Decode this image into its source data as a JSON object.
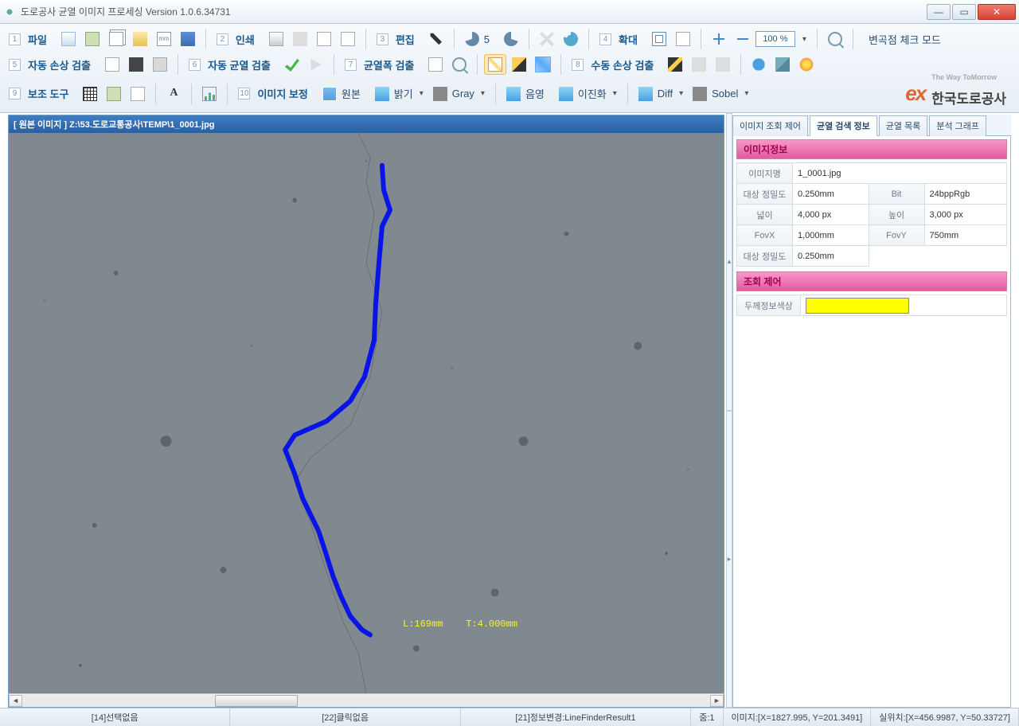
{
  "window": {
    "title": "도로공사 균열 이미지 프로세싱 Version 1.0.6.34731"
  },
  "toolbar": {
    "file": {
      "num": "1",
      "label": "파일"
    },
    "print": {
      "num": "2",
      "label": "인쇄"
    },
    "edit": {
      "num": "3",
      "label": "편집"
    },
    "zoom": {
      "num": "4",
      "label": "확대"
    },
    "zoom_value": "100 %",
    "undo_count": "5",
    "checkmode": "변곡점 체크 모드",
    "auto_damage": {
      "num": "5",
      "label": "자동 손상 검출"
    },
    "auto_crack": {
      "num": "6",
      "label": "자동 균열 검출"
    },
    "crack_width": {
      "num": "7",
      "label": "균열폭 검출"
    },
    "manual_damage": {
      "num": "8",
      "label": "수동 손상 검출"
    },
    "aux_tool": {
      "num": "9",
      "label": "보조 도구"
    },
    "img_corr": {
      "num": "10",
      "label": "이미지 보정"
    },
    "orig": "원본",
    "bright": "밝기",
    "gray": "Gray",
    "shade": "음영",
    "binarize": "이진화",
    "diff": "Diff",
    "sobel": "Sobel",
    "mm": "mm",
    "A": "A"
  },
  "logo": {
    "ex": "ex",
    "text": "한국도로공사",
    "sub": "The Way ToMorrow"
  },
  "image_pane": {
    "title": "[ 원본 이미지 ]  Z:\\53.도로교통공사\\TEMP\\1_0001.jpg",
    "measure": "L:169mm    T:4.000mm"
  },
  "side": {
    "tabs": [
      "이미지 조회 제어",
      "균열 검색 정보",
      "균열 목록",
      "분석 그래프"
    ],
    "active_tab": 1,
    "section_info": "이미지정보",
    "section_ctrl": "조회 제어",
    "props": {
      "img_name_k": "이미지명",
      "img_name_v": "1_0001.jpg",
      "precision_k": "대상 정밀도",
      "precision_v": "0.250mm",
      "bit_k": "Bit",
      "bit_v": "24bppRgb",
      "width_k": "넓이",
      "width_v": "4,000 px",
      "height_k": "높이",
      "height_v": "3,000 px",
      "fovx_k": "FovX",
      "fovx_v": "1,000mm",
      "fovy_k": "FovY",
      "fovy_v": "750mm",
      "precision2_k": "대상 정밀도",
      "precision2_v": "0.250mm",
      "thick_color_k": "두께정보색상"
    }
  },
  "status": {
    "sel": "[14]선택없음",
    "click": "[22]클릭없음",
    "info": "[21]정보변경:LineFinderResult1",
    "zoom": "줌:1",
    "img_pos": "이미지:[X=1827.995, Y=201.3491]",
    "real_pos": "실위치:[X=456.9987, Y=50.33727]"
  }
}
